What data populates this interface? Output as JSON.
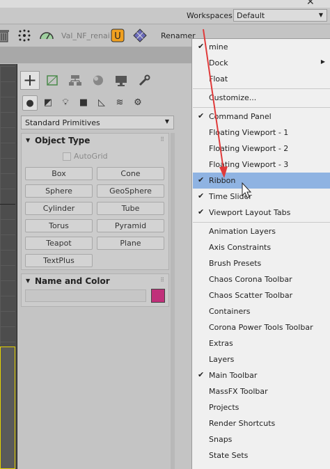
{
  "workspaces": {
    "label": "Workspaces:",
    "value": "Default"
  },
  "toolbar": {
    "layer_name": "Val_NF_renai",
    "renamer": "Renamer"
  },
  "command_panel": {
    "category": "Standard Primitives",
    "object_type": {
      "title": "Object Type",
      "autogrid": "AutoGrid",
      "buttons": [
        "Box",
        "Cone",
        "Sphere",
        "GeoSphere",
        "Cylinder",
        "Tube",
        "Torus",
        "Pyramid",
        "Teapot",
        "Plane",
        "TextPlus"
      ]
    },
    "name_color": {
      "title": "Name and Color",
      "name_value": "",
      "color": "#c0307a"
    }
  },
  "menu": {
    "items": [
      {
        "label": "mine",
        "checked": true
      },
      {
        "label": "Dock",
        "submenu": true
      },
      {
        "label": "Float"
      },
      {
        "label": "Customize..."
      },
      {
        "label": "Command Panel",
        "checked": true
      },
      {
        "label": "Floating Viewport - 1"
      },
      {
        "label": "Floating Viewport - 2"
      },
      {
        "label": "Floating Viewport - 3"
      },
      {
        "label": "Ribbon",
        "checked": true,
        "highlighted": true
      },
      {
        "label": "Time Slider",
        "checked": true
      },
      {
        "label": "Viewport Layout Tabs",
        "checked": true
      },
      {
        "label": "Animation Layers"
      },
      {
        "label": "Axis Constraints"
      },
      {
        "label": "Brush Presets"
      },
      {
        "label": "Chaos Corona Toolbar"
      },
      {
        "label": "Chaos Scatter Toolbar"
      },
      {
        "label": "Containers"
      },
      {
        "label": "Corona Power Tools Toolbar"
      },
      {
        "label": "Extras"
      },
      {
        "label": "Layers"
      },
      {
        "label": "Main Toolbar",
        "checked": true
      },
      {
        "label": "MassFX Toolbar"
      },
      {
        "label": "Projects"
      },
      {
        "label": "Render Shortcuts"
      },
      {
        "label": "Snaps"
      },
      {
        "label": "State Sets"
      }
    ]
  },
  "colors": {
    "highlight": "#8fb3e2",
    "annotation_arrow": "#e03a3a",
    "swatch": "#c0307a"
  }
}
